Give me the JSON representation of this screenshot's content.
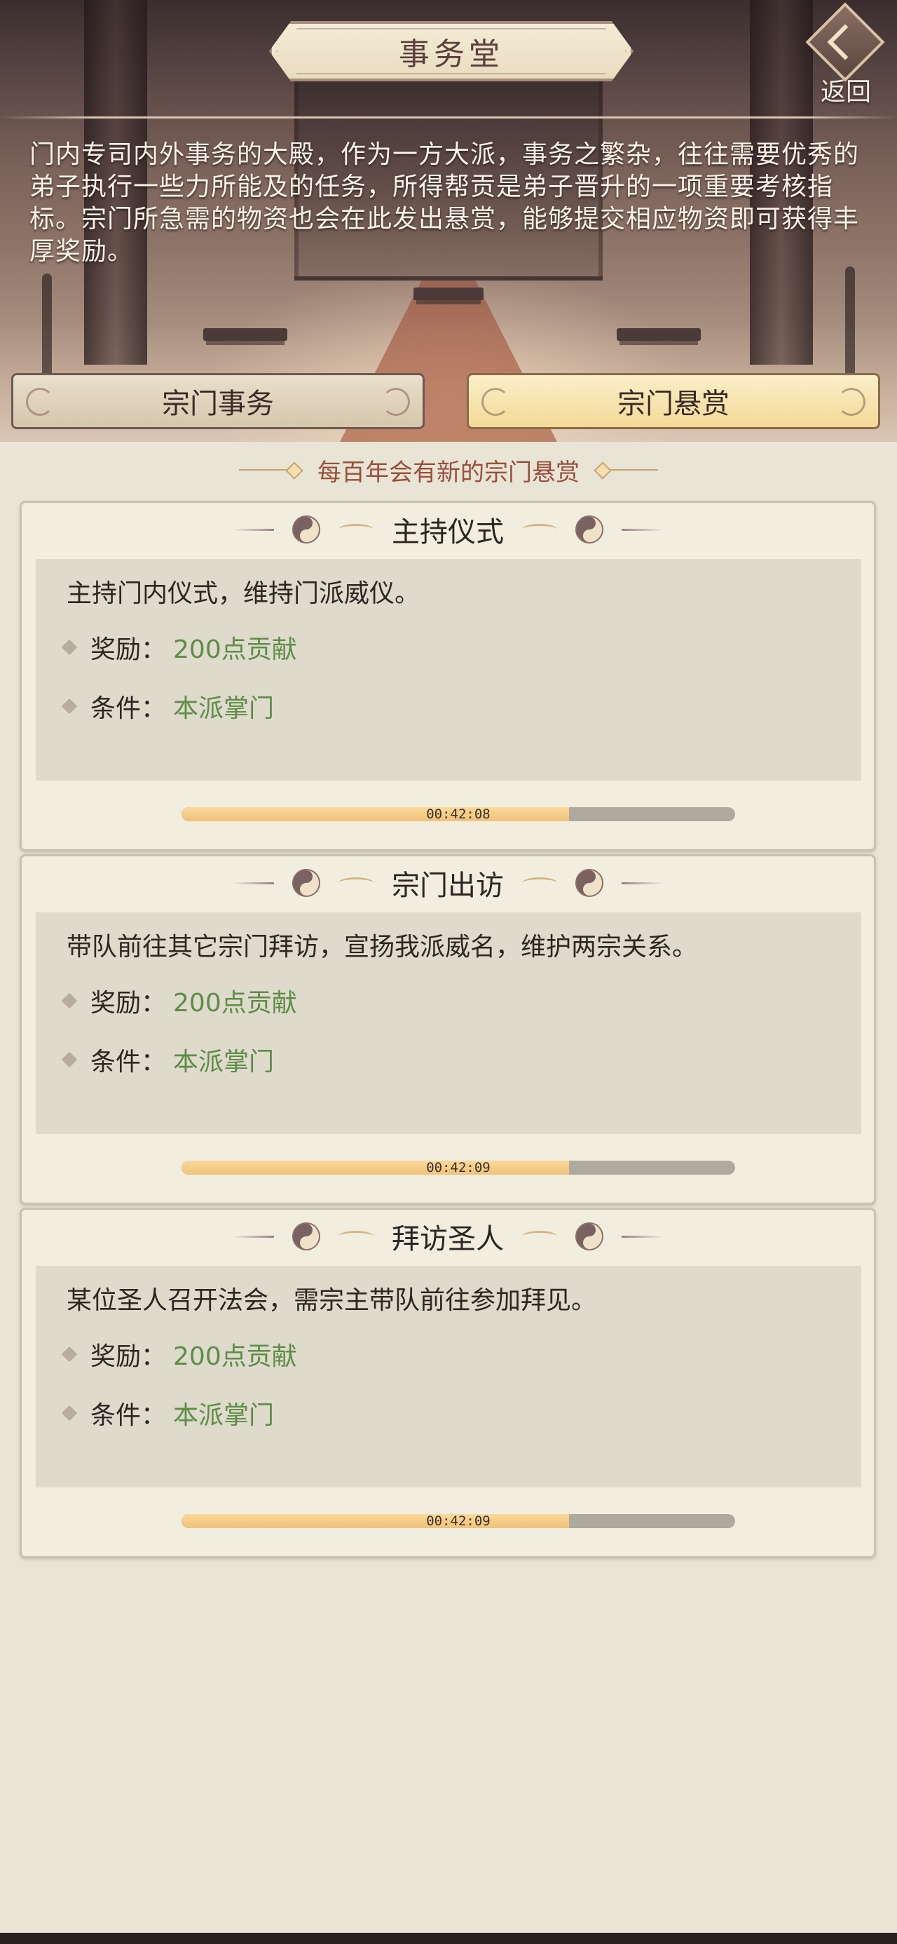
{
  "header": {
    "title": "事务堂",
    "back_label": "返回",
    "intro": "门内专司内外事务的大殿，作为一方大派，事务之繁杂，往往需要优秀的弟子执行一些力所能及的任务，所得帮贡是弟子晋升的一项重要考核指标。宗门所急需的物资也会在此发出悬赏，能够提交相应物资即可获得丰厚奖励。"
  },
  "tabs": [
    {
      "label": "宗门事务",
      "active": false
    },
    {
      "label": "宗门悬赏",
      "active": true
    }
  ],
  "notice": "每百年会有新的宗门悬赏",
  "labels": {
    "reward": "奖励：",
    "condition": "条件："
  },
  "bounties": [
    {
      "title": "主持仪式",
      "description": "主持门内仪式，维持门派威仪。",
      "reward": "200点贡献",
      "condition": "本派掌门",
      "time_left": "00:42:08",
      "progress": 0.7
    },
    {
      "title": "宗门出访",
      "description": "带队前往其它宗门拜访，宣扬我派威名，维护两宗关系。",
      "reward": "200点贡献",
      "condition": "本派掌门",
      "time_left": "00:42:09",
      "progress": 0.7
    },
    {
      "title": "拜访圣人",
      "description": "某位圣人召开法会，需宗主带队前往参加拜见。",
      "reward": "200点贡献",
      "condition": "本派掌门",
      "time_left": "00:42:09",
      "progress": 0.7
    }
  ],
  "colors": {
    "accent_green": "#5f8c46",
    "notice_red": "#9a4f3c",
    "progress_fill": "#f0c27a"
  }
}
